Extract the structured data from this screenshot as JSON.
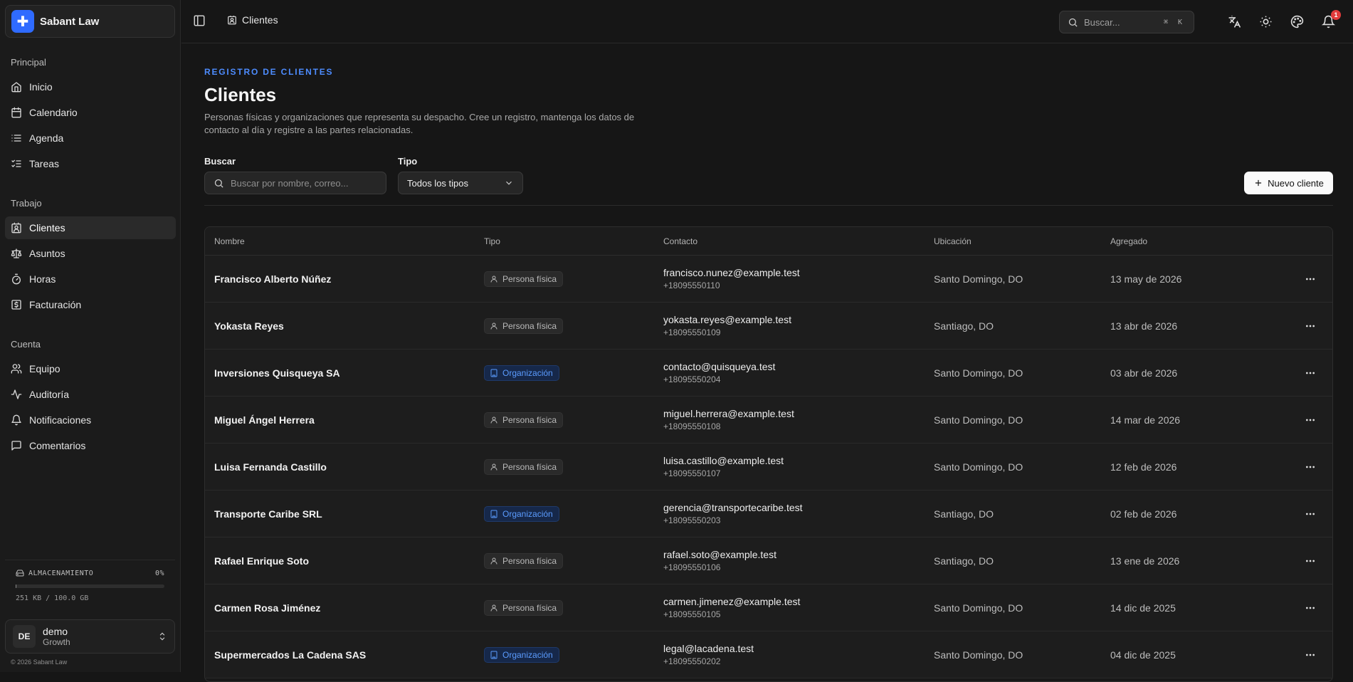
{
  "app": {
    "name": "Sabant Law",
    "copyright": "© 2026 Sabant Law"
  },
  "sidebar": {
    "sections": [
      {
        "heading": "Principal",
        "items": [
          {
            "label": "Inicio",
            "icon": "home-icon"
          },
          {
            "label": "Calendario",
            "icon": "calendar-icon"
          },
          {
            "label": "Agenda",
            "icon": "list-icon"
          },
          {
            "label": "Tareas",
            "icon": "tasks-icon"
          }
        ]
      },
      {
        "heading": "Trabajo",
        "items": [
          {
            "label": "Clientes",
            "icon": "contact-icon",
            "active": true
          },
          {
            "label": "Asuntos",
            "icon": "scale-icon"
          },
          {
            "label": "Horas",
            "icon": "timer-icon"
          },
          {
            "label": "Facturación",
            "icon": "billing-icon"
          }
        ]
      },
      {
        "heading": "Cuenta",
        "items": [
          {
            "label": "Equipo",
            "icon": "team-icon"
          },
          {
            "label": "Auditoría",
            "icon": "audit-icon"
          },
          {
            "label": "Notificaciones",
            "icon": "bell-icon"
          },
          {
            "label": "Comentarios",
            "icon": "comment-icon"
          }
        ]
      }
    ],
    "storage": {
      "label": "ALMACENAMIENTO",
      "percent_label": "0%",
      "percent": 0.003,
      "usage": "251 KB / 100.0 GB"
    },
    "user": {
      "initials": "DE",
      "name": "demo",
      "plan": "Growth"
    }
  },
  "topbar": {
    "breadcrumb": "Clientes",
    "search_placeholder": "Buscar...",
    "search_shortcut": "⌘ K",
    "notification_count": "1"
  },
  "page": {
    "eyebrow": "REGISTRO DE CLIENTES",
    "title": "Clientes",
    "description": "Personas físicas y organizaciones que representa su despacho. Cree un registro, mantenga los datos de contacto al día y registre a las partes relacionadas.",
    "search_label": "Buscar",
    "search_placeholder": "Buscar por nombre, correo...",
    "type_label": "Tipo",
    "type_value": "Todos los tipos",
    "new_button": "Nuevo cliente"
  },
  "table": {
    "columns": [
      "Nombre",
      "Tipo",
      "Contacto",
      "Ubicación",
      "Agregado"
    ],
    "rows": [
      {
        "name": "Francisco Alberto Núñez",
        "type": "Persona física",
        "kind": "person",
        "email": "francisco.nunez@example.test",
        "phone": "+18095550110",
        "location": "Santo Domingo, DO",
        "added": "13 may de 2026"
      },
      {
        "name": "Yokasta Reyes",
        "type": "Persona física",
        "kind": "person",
        "email": "yokasta.reyes@example.test",
        "phone": "+18095550109",
        "location": "Santiago, DO",
        "added": "13 abr de 2026"
      },
      {
        "name": "Inversiones Quisqueya SA",
        "type": "Organización",
        "kind": "org",
        "email": "contacto@quisqueya.test",
        "phone": "+18095550204",
        "location": "Santo Domingo, DO",
        "added": "03 abr de 2026"
      },
      {
        "name": "Miguel Ángel Herrera",
        "type": "Persona física",
        "kind": "person",
        "email": "miguel.herrera@example.test",
        "phone": "+18095550108",
        "location": "Santo Domingo, DO",
        "added": "14 mar de 2026"
      },
      {
        "name": "Luisa Fernanda Castillo",
        "type": "Persona física",
        "kind": "person",
        "email": "luisa.castillo@example.test",
        "phone": "+18095550107",
        "location": "Santo Domingo, DO",
        "added": "12 feb de 2026"
      },
      {
        "name": "Transporte Caribe SRL",
        "type": "Organización",
        "kind": "org",
        "email": "gerencia@transportecaribe.test",
        "phone": "+18095550203",
        "location": "Santiago, DO",
        "added": "02 feb de 2026"
      },
      {
        "name": "Rafael Enrique Soto",
        "type": "Persona física",
        "kind": "person",
        "email": "rafael.soto@example.test",
        "phone": "+18095550106",
        "location": "Santiago, DO",
        "added": "13 ene de 2026"
      },
      {
        "name": "Carmen Rosa Jiménez",
        "type": "Persona física",
        "kind": "person",
        "email": "carmen.jimenez@example.test",
        "phone": "+18095550105",
        "location": "Santo Domingo, DO",
        "added": "14 dic de 2025"
      },
      {
        "name": "Supermercados La Cadena SAS",
        "type": "Organización",
        "kind": "org",
        "email": "legal@lacadena.test",
        "phone": "+18095550202",
        "location": "Santo Domingo, DO",
        "added": "04 dic de 2025"
      }
    ]
  },
  "colors": {
    "accent": "#2f6bff",
    "eyebrow": "#4d8cff",
    "org_badge": "#5b9cff",
    "notification": "#e23b3b"
  }
}
